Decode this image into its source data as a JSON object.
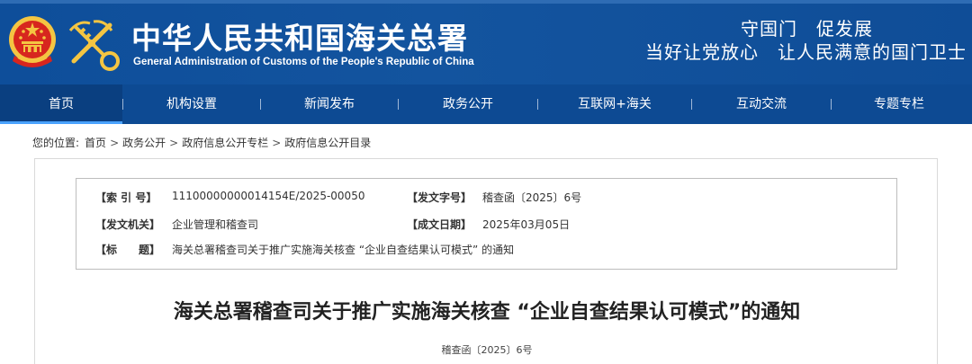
{
  "header": {
    "title_cn": "中华人民共和国海关总署",
    "title_en": "General Administration of Customs of the People's Republic of China",
    "slogan_line1": "守国门　促发展",
    "slogan_line2": "当好让党放心　让人民满意的国门卫士",
    "emblem_icon": "national-emblem-icon",
    "logo_icon": "customs-emblem-icon"
  },
  "nav": {
    "items": [
      {
        "label": "首页",
        "active": true
      },
      {
        "label": "机构设置"
      },
      {
        "label": "新闻发布"
      },
      {
        "label": "政务公开"
      },
      {
        "label": "互联网+海关"
      },
      {
        "label": "互动交流"
      },
      {
        "label": "专题专栏"
      }
    ]
  },
  "breadcrumb": {
    "prefix": "您的位置:",
    "items": [
      "首页",
      "政务公开",
      "政府信息公开专栏",
      "政府信息公开目录"
    ],
    "separator": ">"
  },
  "meta": {
    "index_label": "【索 引 号】",
    "index_value": "11100000000014154E/2025-00050",
    "doc_no_label": "【发文字号】",
    "doc_no_value": "稽查函〔2025〕6号",
    "issuer_label": "【发文机关】",
    "issuer_value": "企业管理和稽查司",
    "date_label": "【成文日期】",
    "date_value": "2025年03月05日",
    "title_label": "【标　　题】",
    "title_value": "海关总署稽查司关于推广实施海关核查 “企业自查结果认可模式” 的通知"
  },
  "document": {
    "title": "海关总署稽查司关于推广实施海关核查 “企业自查结果认可模式”的通知",
    "number": "稽查函〔2025〕6号"
  },
  "colors": {
    "header_blue": "#13549f",
    "nav_blue": "#0d4a93",
    "emblem_red": "#d7261e",
    "emblem_gold": "#f4c542"
  }
}
